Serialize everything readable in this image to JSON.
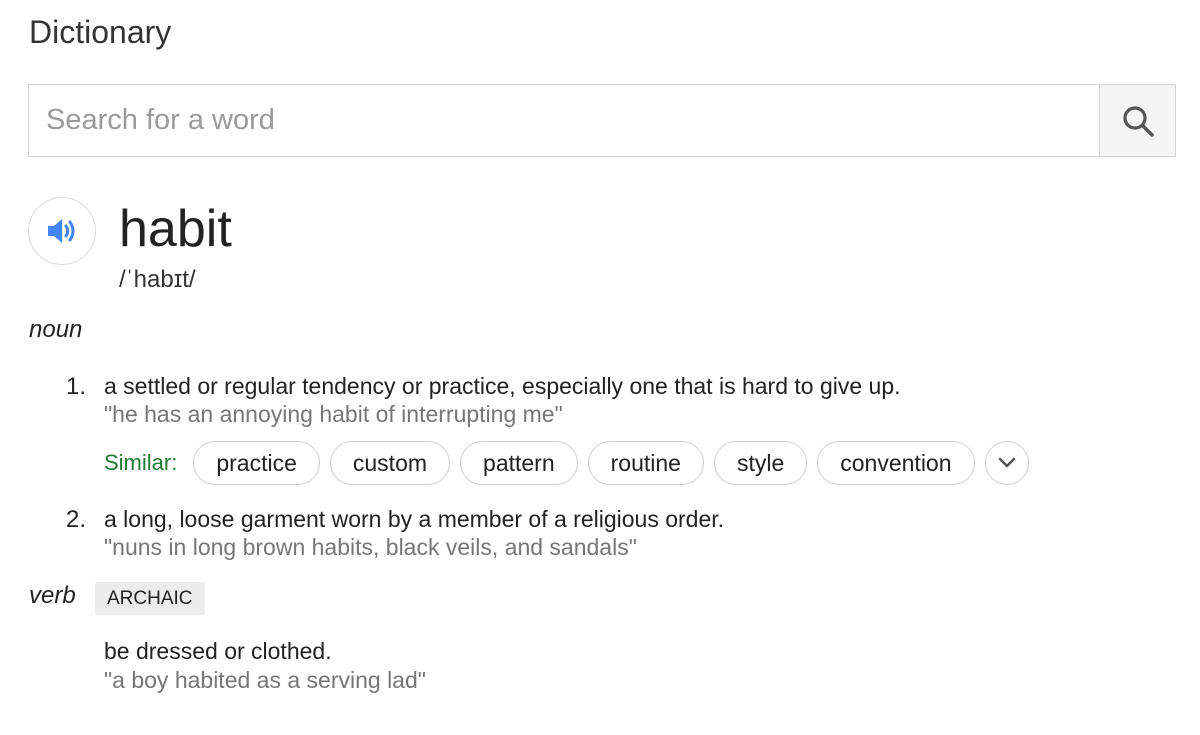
{
  "header": {
    "title": "Dictionary"
  },
  "search": {
    "placeholder": "Search for a word",
    "value": "",
    "button_icon": "search-icon"
  },
  "entry": {
    "audio_icon": "speaker-icon",
    "word": "habit",
    "phonetic": "/ˈhabɪt/",
    "noun": {
      "label": "noun",
      "senses": [
        {
          "number": "1.",
          "definition": "a settled or regular tendency or practice, especially one that is hard to give up.",
          "example": "\"he has an annoying habit of interrupting me\"",
          "similar_label": "Similar:",
          "similar": [
            "practice",
            "custom",
            "pattern",
            "routine",
            "style",
            "convention"
          ],
          "expand_icon": "chevron-down-icon"
        },
        {
          "number": "2.",
          "definition": "a long, loose garment worn by a member of a religious order.",
          "example": "\"nuns in long brown habits, black veils, and sandals\""
        }
      ]
    },
    "verb": {
      "label": "verb",
      "badge": "ARCHAIC",
      "definition": "be dressed or clothed.",
      "example": "\"a boy habited as a serving lad\""
    }
  },
  "colors": {
    "accent_blue": "#4285f4",
    "similar_green": "#1f7a34",
    "example_gray": "#767676"
  }
}
